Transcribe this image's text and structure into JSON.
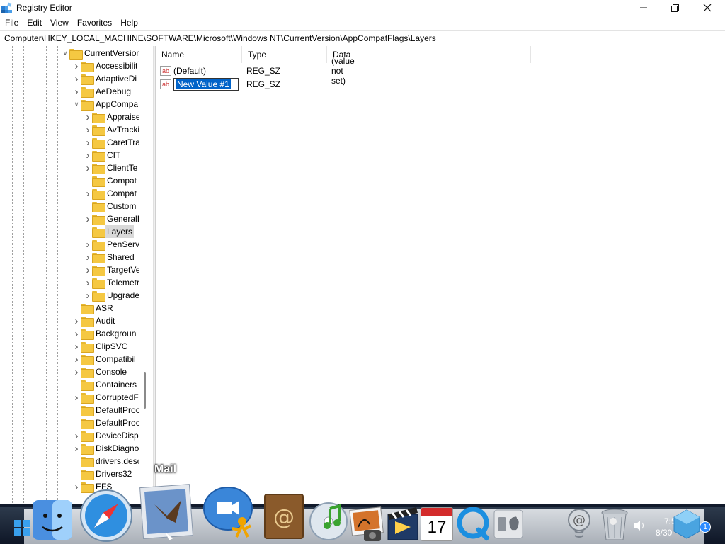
{
  "window": {
    "title": "Registry Editor"
  },
  "menu": [
    "File",
    "Edit",
    "View",
    "Favorites",
    "Help"
  ],
  "address": "Computer\\HKEY_LOCAL_MACHINE\\SOFTWARE\\Microsoft\\Windows NT\\CurrentVersion\\AppCompatFlags\\Layers",
  "tree": [
    {
      "label": "CurrentVersion",
      "level": 0,
      "expander": "down"
    },
    {
      "label": "Accessibilit",
      "level": 1,
      "expander": "right"
    },
    {
      "label": "AdaptiveDi",
      "level": 1,
      "expander": "right"
    },
    {
      "label": "AeDebug",
      "level": 1,
      "expander": "right"
    },
    {
      "label": "AppCompa",
      "level": 1,
      "expander": "down"
    },
    {
      "label": "Appraise",
      "level": 2,
      "expander": "right"
    },
    {
      "label": "AvTracki",
      "level": 2,
      "expander": "right"
    },
    {
      "label": "CaretTra",
      "level": 2,
      "expander": "right"
    },
    {
      "label": "CIT",
      "level": 2,
      "expander": "right"
    },
    {
      "label": "ClientTe",
      "level": 2,
      "expander": "right"
    },
    {
      "label": "Compat",
      "level": 2,
      "expander": "none"
    },
    {
      "label": "Compat",
      "level": 2,
      "expander": "right"
    },
    {
      "label": "Custom",
      "level": 2,
      "expander": "none"
    },
    {
      "label": "GeneralI",
      "level": 2,
      "expander": "right"
    },
    {
      "label": "Layers",
      "level": 2,
      "expander": "none",
      "selected": true
    },
    {
      "label": "PenServ",
      "level": 2,
      "expander": "right"
    },
    {
      "label": "Shared",
      "level": 2,
      "expander": "right"
    },
    {
      "label": "TargetVe",
      "level": 2,
      "expander": "right"
    },
    {
      "label": "Telemetr",
      "level": 2,
      "expander": "right"
    },
    {
      "label": "Upgrade",
      "level": 2,
      "expander": "right"
    },
    {
      "label": "ASR",
      "level": 1,
      "expander": "none"
    },
    {
      "label": "Audit",
      "level": 1,
      "expander": "right"
    },
    {
      "label": "Backgroun",
      "level": 1,
      "expander": "right"
    },
    {
      "label": "ClipSVC",
      "level": 1,
      "expander": "right"
    },
    {
      "label": "Compatibil",
      "level": 1,
      "expander": "right"
    },
    {
      "label": "Console",
      "level": 1,
      "expander": "right"
    },
    {
      "label": "Containers",
      "level": 1,
      "expander": "none"
    },
    {
      "label": "CorruptedF",
      "level": 1,
      "expander": "right"
    },
    {
      "label": "DefaultProc",
      "level": 1,
      "expander": "none"
    },
    {
      "label": "DefaultProc",
      "level": 1,
      "expander": "none"
    },
    {
      "label": "DeviceDisp",
      "level": 1,
      "expander": "right"
    },
    {
      "label": "DiskDiagno",
      "level": 1,
      "expander": "right"
    },
    {
      "label": "drivers.desc",
      "level": 1,
      "expander": "none"
    },
    {
      "label": "Drivers32",
      "level": 1,
      "expander": "none"
    },
    {
      "label": "EFS",
      "level": 1,
      "expander": "right"
    }
  ],
  "columns": {
    "name": "Name",
    "type": "Type",
    "data": "Data"
  },
  "values": [
    {
      "name": "(Default)",
      "type": "REG_SZ",
      "data": "(value not set)"
    },
    {
      "name": "New Value #1",
      "type": "REG_SZ",
      "data": ""
    }
  ],
  "dock": {
    "hover_label": "Mail",
    "icons": [
      "finder-icon",
      "safari-icon",
      "mail-icon",
      "ichat-icon",
      "address-book-icon",
      "itunes-icon",
      "iphoto-icon",
      "imovie-icon",
      "ical-icon",
      "quicktime-icon",
      "boot-camp-icon",
      "network-icon",
      "trash-icon"
    ],
    "ical_day": "17"
  },
  "clock": {
    "time": "7:5",
    "date": "8/30"
  },
  "badge": "1",
  "colors": {
    "selection": "#0063c9",
    "folder": "#f5c842"
  }
}
